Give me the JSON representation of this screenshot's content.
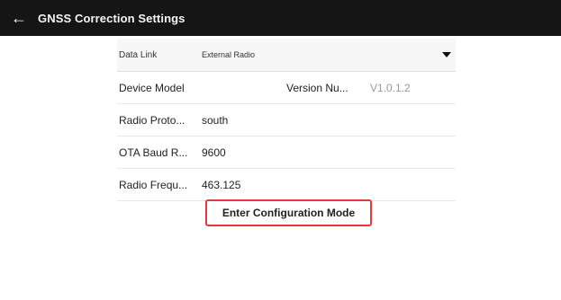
{
  "header": {
    "back_icon": "arrow-left-icon",
    "title": "GNSS Correction Settings"
  },
  "settings": {
    "data_link": {
      "label": "Data Link",
      "value": "External Radio",
      "dropdown_icon": "caret-down-icon"
    },
    "device_model": {
      "label": "Device Model",
      "value": ""
    },
    "version": {
      "label": "Version Nu...",
      "value": "V1.0.1.2"
    },
    "radio_protocol": {
      "label": "Radio Proto...",
      "value": "south"
    },
    "ota_baud_rate": {
      "label": "OTA Baud R...",
      "value": "9600"
    },
    "radio_frequency": {
      "label": "Radio Frequ...",
      "value": "463.125"
    }
  },
  "actions": {
    "enter_config_label": "Enter Configuration Mode"
  },
  "colors": {
    "topbar": "#151515",
    "highlight_border": "#e23a3a",
    "muted_text": "#9a9a9a"
  }
}
